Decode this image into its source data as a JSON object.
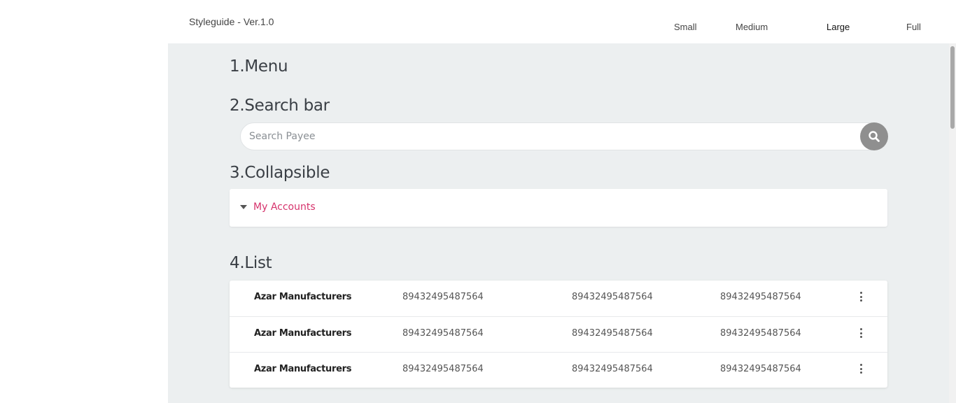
{
  "header": {
    "title": "Styleguide - Ver.1.0",
    "sizes": [
      "Small",
      "Medium",
      "Large",
      "Full"
    ],
    "active_size": "Large"
  },
  "sections": {
    "menu": "1.Menu",
    "search": "2.Search bar",
    "collapsible": "3.Collapsible",
    "list": "4.List"
  },
  "search": {
    "placeholder": "Search Payee",
    "icon": "search-icon"
  },
  "collapsible": {
    "label": "My Accounts",
    "icon": "caret-down-icon",
    "label_color": "#d6336c"
  },
  "list": {
    "items": [
      {
        "name": "Azar Manufacturers",
        "col1": "89432495487564",
        "col2": "89432495487564",
        "col3": "89432495487564"
      },
      {
        "name": "Azar Manufacturers",
        "col1": "89432495487564",
        "col2": "89432495487564",
        "col3": "89432495487564"
      },
      {
        "name": "Azar Manufacturers",
        "col1": "89432495487564",
        "col2": "89432495487564",
        "col3": "89432495487564"
      }
    ],
    "row_icon": "more-vertical-icon"
  },
  "colors": {
    "content_background": "#eceff0",
    "search_button": "#8f8f8f"
  }
}
